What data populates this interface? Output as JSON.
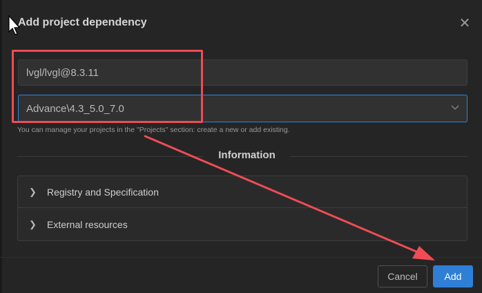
{
  "dialog": {
    "title": "Add project dependency",
    "close_icon": "close-icon"
  },
  "form": {
    "package_value": "lvgl/lvgl@8.3.11",
    "project_value": "Advance\\4.3_5.0_7.0",
    "hint": "You can manage your projects in the \"Projects\" section: create a new or add existing."
  },
  "information": {
    "heading": "Information",
    "items": [
      {
        "label": "Registry and Specification"
      },
      {
        "label": "External resources"
      }
    ]
  },
  "buttons": {
    "cancel_label": "Cancel",
    "add_label": "Add"
  },
  "colors": {
    "accent": "#2f7fd6",
    "annotation": "#ef4c55",
    "background": "#252526"
  }
}
